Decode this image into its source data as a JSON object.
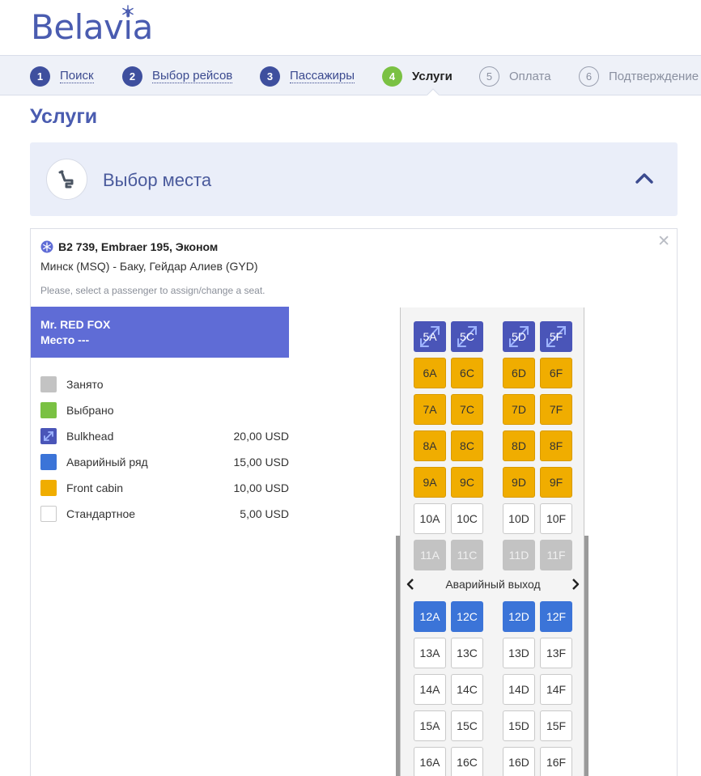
{
  "brand": {
    "name": "Belavia",
    "color": "#4a5cb0"
  },
  "steps": [
    {
      "num": "1",
      "label": "Поиск",
      "state": "done"
    },
    {
      "num": "2",
      "label": "Выбор рейсов",
      "state": "done"
    },
    {
      "num": "3",
      "label": "Пассажиры",
      "state": "done"
    },
    {
      "num": "4",
      "label": "Услуги",
      "state": "active"
    },
    {
      "num": "5",
      "label": "Оплата",
      "state": "future"
    },
    {
      "num": "6",
      "label": "Подтверждение",
      "state": "future"
    }
  ],
  "page_title": "Услуги",
  "service": {
    "title": "Выбор места",
    "icon": "seat-icon",
    "expanded": true
  },
  "flight": {
    "title": "B2 739, Embraer 195, Эконом",
    "route": "Минск (MSQ) - Баку, Гейдар Алиев (GYD)",
    "hint": "Please, select a passenger to assign/change a seat."
  },
  "passenger": {
    "name": "Mr. RED FOX",
    "seat": "Место ---"
  },
  "legend": [
    {
      "label": "Занято",
      "price": "",
      "color": "#c3c3c3",
      "type": "occupied"
    },
    {
      "label": "Выбрано",
      "price": "",
      "color": "#7ac143",
      "type": "selected"
    },
    {
      "label": "Bulkhead",
      "price": "20,00 USD",
      "color": "#4a55b8",
      "type": "bulkhead"
    },
    {
      "label": "Аварийный ряд",
      "price": "15,00 USD",
      "color": "#3b74d8",
      "type": "emergency"
    },
    {
      "label": "Front cabin",
      "price": "10,00 USD",
      "color": "#f0ad00",
      "type": "front"
    },
    {
      "label": "Стандартное",
      "price": "5,00 USD",
      "color": "#ffffff",
      "type": "standard"
    }
  ],
  "seat_map": {
    "columns": [
      "A",
      "C",
      "D",
      "F"
    ],
    "exit_label": "Аварийный выход",
    "rows": [
      {
        "row": "5",
        "type": "bulkhead",
        "seats": [
          "5A",
          "5C",
          "5D",
          "5F"
        ]
      },
      {
        "row": "6",
        "type": "front",
        "seats": [
          "6A",
          "6C",
          "6D",
          "6F"
        ]
      },
      {
        "row": "7",
        "type": "front",
        "seats": [
          "7A",
          "7C",
          "7D",
          "7F"
        ]
      },
      {
        "row": "8",
        "type": "front",
        "seats": [
          "8A",
          "8C",
          "8D",
          "8F"
        ]
      },
      {
        "row": "9",
        "type": "front",
        "seats": [
          "9A",
          "9C",
          "9D",
          "9F"
        ]
      },
      {
        "row": "10",
        "type": "standard",
        "seats": [
          "10A",
          "10C",
          "10D",
          "10F"
        ]
      },
      {
        "row": "11",
        "type": "occupied",
        "seats": [
          "11A",
          "11C",
          "11D",
          "11F"
        ]
      },
      {
        "row": "12",
        "type": "emergency",
        "seats": [
          "12A",
          "12C",
          "12D",
          "12F"
        ]
      },
      {
        "row": "13",
        "type": "standard",
        "seats": [
          "13A",
          "13C",
          "13D",
          "13F"
        ]
      },
      {
        "row": "14",
        "type": "standard",
        "seats": [
          "14A",
          "14C",
          "14D",
          "14F"
        ]
      },
      {
        "row": "15",
        "type": "standard",
        "seats": [
          "15A",
          "15C",
          "15D",
          "15F"
        ]
      },
      {
        "row": "16",
        "type": "standard",
        "seats": [
          "16A",
          "16C",
          "16D",
          "16F"
        ]
      }
    ]
  }
}
